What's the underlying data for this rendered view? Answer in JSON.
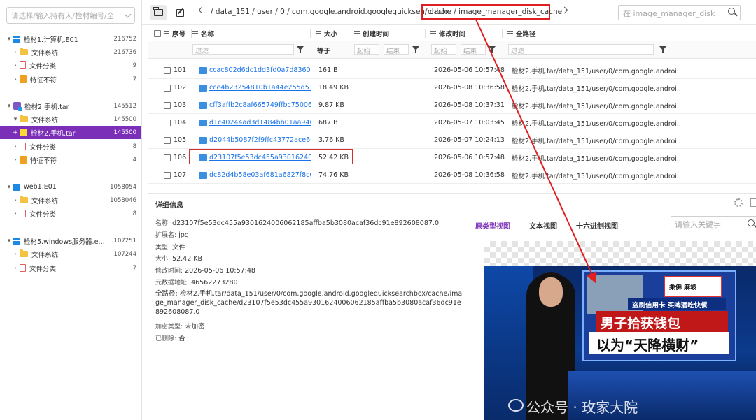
{
  "sidebar": {
    "search_placeholder": "请选择/输入持有人/检材编号/全",
    "tree": [
      {
        "toggle": "▾",
        "icon": "windows-icon",
        "label": "检材1.计算机.E01",
        "count": "216752",
        "indent": 0
      },
      {
        "toggle": "›",
        "icon": "folder-icon",
        "label": "文件系统",
        "count": "216736",
        "indent": 1
      },
      {
        "toggle": "›",
        "icon": "document-icon",
        "label": "文件分类",
        "count": "9",
        "indent": 1
      },
      {
        "toggle": "›",
        "icon": "warning-icon",
        "label": "特征不符",
        "count": "7",
        "indent": 1
      },
      {
        "toggle": "▾",
        "icon": "archive-icon",
        "label": "检材2.手机.tar",
        "count": "145512",
        "indent": 0
      },
      {
        "toggle": "▾",
        "icon": "folder-icon",
        "label": "文件系统",
        "count": "145500",
        "indent": 1
      },
      {
        "toggle": "+",
        "icon": "archive-file-icon",
        "label": "检材2.手机.tar",
        "count": "145500",
        "indent": 1,
        "selected": true
      },
      {
        "toggle": "›",
        "icon": "document-icon",
        "label": "文件分类",
        "count": "8",
        "indent": 1
      },
      {
        "toggle": "›",
        "icon": "warning-icon",
        "label": "特征不符",
        "count": "4",
        "indent": 1
      },
      {
        "toggle": "▾",
        "icon": "windows-icon",
        "label": "web1.E01",
        "count": "1058054",
        "indent": 0
      },
      {
        "toggle": "›",
        "icon": "folder-icon",
        "label": "文件系统",
        "count": "1058046",
        "indent": 1
      },
      {
        "toggle": "›",
        "icon": "document-icon",
        "label": "文件分类",
        "count": "8",
        "indent": 1
      },
      {
        "toggle": "▾",
        "icon": "windows-icon",
        "label": "检材5.windows服务器.e01",
        "count": "107251",
        "indent": 0
      },
      {
        "toggle": "›",
        "icon": "folder-icon",
        "label": "文件系统",
        "count": "107244",
        "indent": 1
      },
      {
        "toggle": "›",
        "icon": "document-icon",
        "label": "文件分类",
        "count": "7",
        "indent": 1
      }
    ]
  },
  "toolbar": {
    "path_prefix": "/ data_151 / user / 0 / com.google.android.googlequicksearchbox",
    "path_highlight": "/ cache / image_manager_disk_cache",
    "search_placeholder": "在 image_manager_disk"
  },
  "grid": {
    "headers": {
      "index": "序号",
      "name": "名称",
      "size": "大小",
      "ctime": "创建时间",
      "mtime": "修改时间",
      "path": "全路径"
    },
    "filters": {
      "name": "过滤",
      "size": "等于",
      "ctime_start": "起始",
      "ctime_end": "结束",
      "mtime_start": "起始",
      "mtime_end": "结束",
      "path": "过滤"
    },
    "rows": [
      {
        "index": "101",
        "name": "ccac802d6dc1dd3fd0a7d83605a61",
        "size": "161 B",
        "mtime": "2026-05-06 10:57:48",
        "path": "检材2.手机.tar/data_151/user/0/com.google.androi..."
      },
      {
        "index": "102",
        "name": "cce4b23254810b1a44e255d518464",
        "size": "18.49 KB",
        "mtime": "2026-05-08 10:36:58",
        "path": "检材2.手机.tar/data_151/user/0/com.google.androi..."
      },
      {
        "index": "103",
        "name": "cff3affb2c8af665749ffbc750062ea6",
        "size": "9.87 KB",
        "mtime": "2026-05-08 10:37:31",
        "path": "检材2.手机.tar/data_151/user/0/com.google.androi..."
      },
      {
        "index": "104",
        "name": "d1c40244ad3d1484bb01aa94695f1",
        "size": "687 B",
        "mtime": "2026-05-07 10:03:45",
        "path": "检材2.手机.tar/data_151/user/0/com.google.androi..."
      },
      {
        "index": "105",
        "name": "d2044b5087f2f9ffc43772ace66834",
        "size": "3.76 KB",
        "mtime": "2026-05-07 10:24:13",
        "path": "检材2.手机.tar/data_151/user/0/com.google.androi..."
      },
      {
        "index": "106",
        "name": "d23107f5e53dc455a930162400606",
        "size": "52.42 KB",
        "mtime": "2026-05-06 10:57:48",
        "path": "检材2.手机.tar/data_151/user/0/com.google.androi...",
        "selected": true
      },
      {
        "index": "107",
        "name": "dc82d4b58e03af681a6827f8c631b",
        "size": "74.76 KB",
        "mtime": "2026-05-08 10:36:58",
        "path": "检材2.手机.tar/data_151/user/0/com.google.androi..."
      }
    ]
  },
  "detail": {
    "title": "详细信息",
    "fields": [
      {
        "key": "名称:",
        "value": "d23107f5e53dc455a9301624006062185affba5b3080acaf36dc91e892608087.0"
      },
      {
        "key": "扩展名:",
        "value": "jpg"
      },
      {
        "key": "类型:",
        "value": "文件"
      },
      {
        "key": "大小:",
        "value": "52.42 KB"
      },
      {
        "key": "修改时间:",
        "value": "2026-05-06 10:57:48"
      },
      {
        "key": "元数据地址:",
        "value": "46562273280"
      }
    ],
    "path_key": "全路径:",
    "path_value": "检材2.手机.tar/data_151/user/0/com.google.android.googlequicksearchbox/cache/image_manager_disk_cache/d23107f5e53dc455a9301624006062185affba5b3080acaf36dc91e892608087.0",
    "fields2": [
      {
        "key": "加密类型:",
        "value": "未加密"
      },
      {
        "key": "已删除:",
        "value": "否"
      }
    ],
    "view_tabs": [
      "原类型视图",
      "文本视图",
      "十六进制视图"
    ],
    "keyword_placeholder": "请输入关键字",
    "preview": {
      "location": "柔佛 麻坡",
      "headline1": "盗刷信用卡 买啤酒吃快餐",
      "headline2": "男子拾获钱包",
      "headline3": "以为“天降横财”",
      "watermark": "公众号 · 玫家大院"
    }
  },
  "colors": {
    "accent": "#7b2fb8",
    "link": "#1a73e8",
    "highlight": "#e02020"
  }
}
